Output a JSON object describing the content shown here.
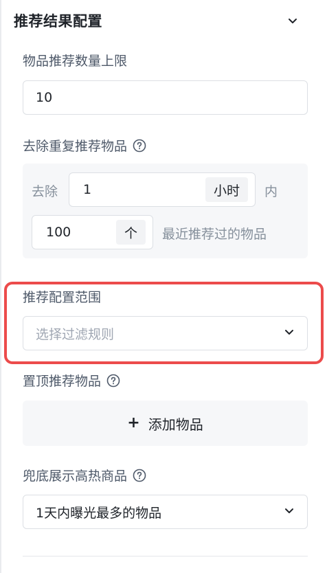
{
  "section": {
    "title": "推荐结果配置"
  },
  "limit": {
    "label": "物品推荐数量上限",
    "value": "10"
  },
  "dedupe": {
    "label": "去除重复推荐物品",
    "prefix": "去除",
    "hours_value": "1",
    "hours_unit": "小时",
    "within": "内",
    "count_value": "100",
    "count_unit": "个",
    "suffix": "最近推荐过的物品"
  },
  "scope": {
    "label": "推荐配置范围",
    "placeholder": "选择过滤规则"
  },
  "pinned": {
    "label": "置顶推荐物品",
    "add_button": "添加物品"
  },
  "fallback": {
    "label": "兜底展示高热商品",
    "selected": "1天内曝光最多的物品"
  },
  "colors": {
    "highlight": "#ec4b4b",
    "panel_bg": "#f6f7f9",
    "border": "#dcdfe4"
  }
}
